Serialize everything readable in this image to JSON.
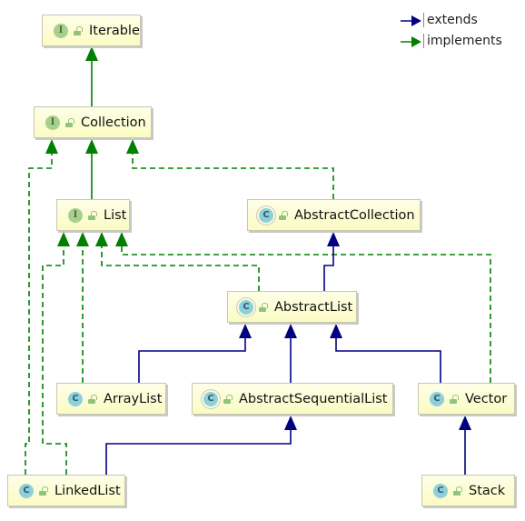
{
  "legend": {
    "extends": {
      "label": "extends",
      "color": "#000080"
    },
    "implements": {
      "label": "implements",
      "color": "#008000"
    }
  },
  "nodes": {
    "iterable": {
      "label": "Iterable",
      "kind": "interface",
      "icon_letter": "I"
    },
    "collection": {
      "label": "Collection",
      "kind": "interface",
      "icon_letter": "I"
    },
    "list": {
      "label": "List",
      "kind": "interface",
      "icon_letter": "I"
    },
    "abstract_collection": {
      "label": "AbstractCollection",
      "kind": "abstract-class",
      "icon_letter": "C"
    },
    "abstract_list": {
      "label": "AbstractList",
      "kind": "abstract-class",
      "icon_letter": "C"
    },
    "array_list": {
      "label": "ArrayList",
      "kind": "class",
      "icon_letter": "C"
    },
    "abstract_sequential_list": {
      "label": "AbstractSequentialList",
      "kind": "abstract-class",
      "icon_letter": "C"
    },
    "vector": {
      "label": "Vector",
      "kind": "class",
      "icon_letter": "C"
    },
    "linked_list": {
      "label": "LinkedList",
      "kind": "class",
      "icon_letter": "C"
    },
    "stack": {
      "label": "Stack",
      "kind": "class",
      "icon_letter": "C"
    }
  },
  "edges": [
    {
      "from": "Collection",
      "to": "Iterable",
      "type": "extends-interface"
    },
    {
      "from": "List",
      "to": "Collection",
      "type": "extends-interface"
    },
    {
      "from": "AbstractCollection",
      "to": "Collection",
      "type": "implements"
    },
    {
      "from": "LinkedList",
      "to": "Collection",
      "type": "implements"
    },
    {
      "from": "LinkedList",
      "to": "List",
      "type": "implements"
    },
    {
      "from": "ArrayList",
      "to": "List",
      "type": "implements"
    },
    {
      "from": "AbstractList",
      "to": "List",
      "type": "implements"
    },
    {
      "from": "Vector",
      "to": "List",
      "type": "implements"
    },
    {
      "from": "AbstractList",
      "to": "AbstractCollection",
      "type": "extends"
    },
    {
      "from": "ArrayList",
      "to": "AbstractList",
      "type": "extends"
    },
    {
      "from": "AbstractSequentialList",
      "to": "AbstractList",
      "type": "extends"
    },
    {
      "from": "Vector",
      "to": "AbstractList",
      "type": "extends"
    },
    {
      "from": "LinkedList",
      "to": "AbstractSequentialList",
      "type": "extends"
    },
    {
      "from": "Stack",
      "to": "Vector",
      "type": "extends"
    }
  ]
}
